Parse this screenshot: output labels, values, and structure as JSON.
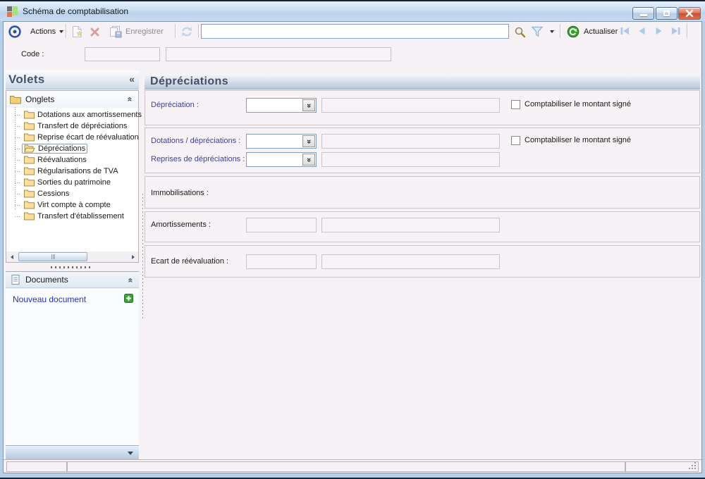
{
  "window": {
    "title": "Schéma de comptabilisation"
  },
  "toolbar": {
    "actions_label": "Actions",
    "save_label": "Enregistrer",
    "refresh_label": "Actualiser",
    "search_value": ""
  },
  "code_row": {
    "label": "Code :",
    "code_value": "",
    "description_value": ""
  },
  "sidebar": {
    "title": "Volets",
    "collapse_glyph": "«",
    "onglets": {
      "label": "Onglets",
      "selected_index": 3,
      "items": [
        "Dotations aux amortissements",
        "Transfert de dépréciations",
        "Reprise écart de réévaluation",
        "Dépréciations",
        "Réévaluations",
        "Régularisations de TVA",
        "Sorties du patrimoine",
        "Cessions",
        "Virt compte à compte",
        "Transfert d'établissement"
      ]
    },
    "documents": {
      "label": "Documents",
      "new_document_label": "Nouveau document"
    }
  },
  "main": {
    "title": "Dépréciations",
    "depreciation": {
      "label": "Dépréciation :",
      "journal_value": "",
      "account_value": "",
      "checkbox_label": "Comptabiliser le montant signé",
      "checked": false
    },
    "dotations": {
      "label": "Dotations / dépréciations :",
      "journal_value": "",
      "account_value": "",
      "checkbox_label": "Comptabiliser le montant signé",
      "checked": false
    },
    "reprises": {
      "label": "Reprises de dépréciations :",
      "journal_value": "",
      "account_value": ""
    },
    "immobilisations": {
      "label": "Immobilisations :"
    },
    "amortissements": {
      "label": "Amortissements :",
      "value": "",
      "account_value": ""
    },
    "ecart": {
      "label": "Ecart de réévaluation :",
      "value": "",
      "account_value": ""
    }
  },
  "icons": {
    "chevron_double_left": "«",
    "chevron_double_right": "»"
  },
  "colors": {
    "titlebar_blue": "#c8daf0",
    "panel_bg": "#f5f1f4",
    "accent_blue_label": "#3f3f9f",
    "header_text": "#445164",
    "close_red": "#c94f31",
    "folder_yellow": "#f8de9a",
    "link_blue": "#2233bb",
    "plus_green": "#3aa33a"
  }
}
